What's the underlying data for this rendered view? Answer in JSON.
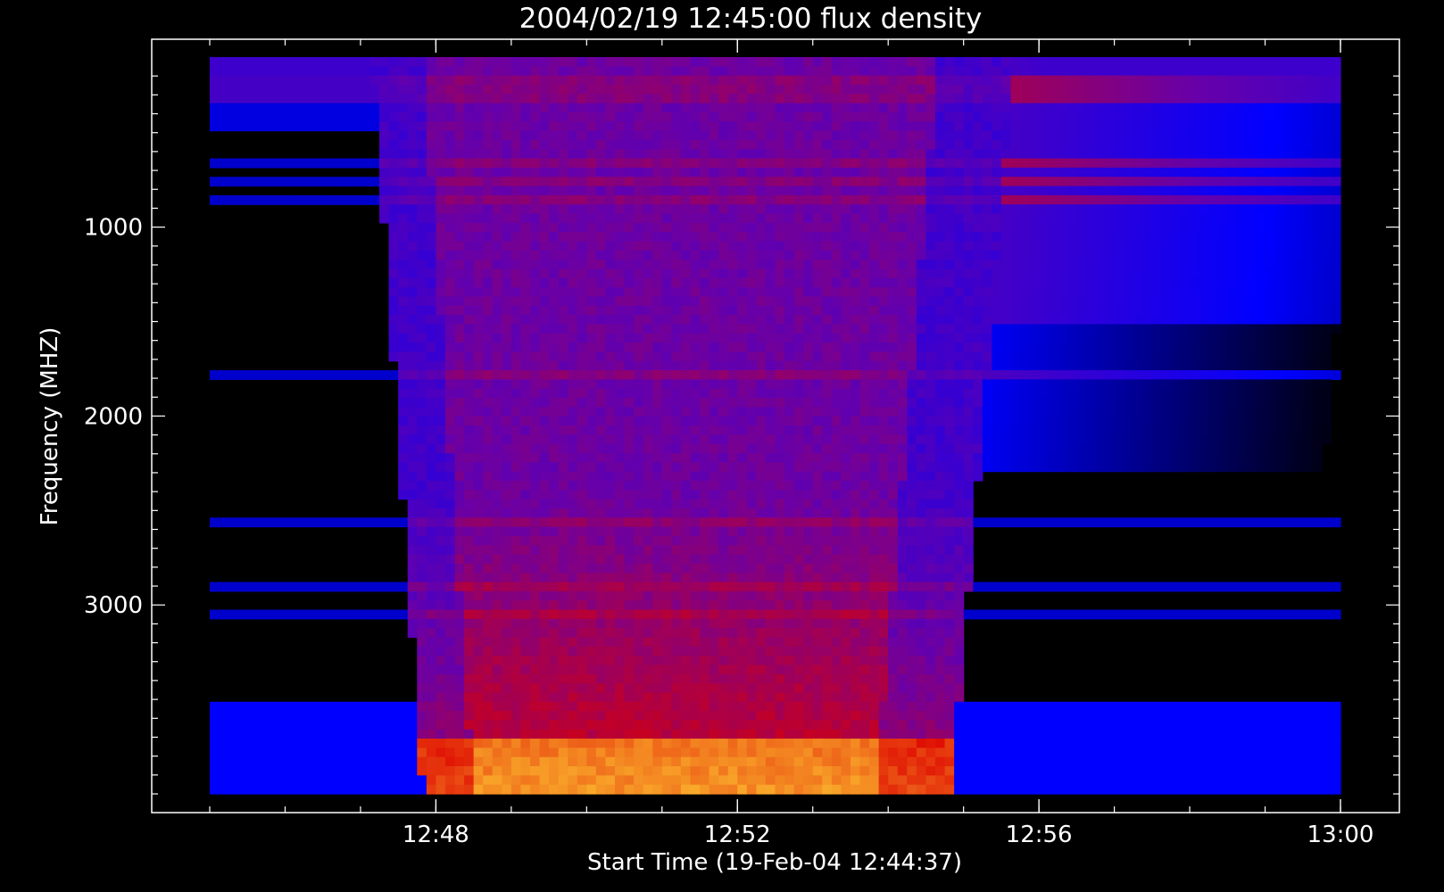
{
  "chart_data": {
    "type": "heatmap",
    "title": "2004/02/19 12:45:00 flux density",
    "xlabel": "Start Time (19-Feb-04 12:44:37)",
    "ylabel": "Frequency (MHZ)",
    "x_tick_labels": [
      "12:48",
      "12:52",
      "12:56",
      "13:00"
    ],
    "y_tick_labels": [
      "1000",
      "2000",
      "3000"
    ],
    "y_ticks": [
      1000,
      2000,
      3000
    ],
    "ylim": [
      4200,
      100
    ],
    "y_axis": "inverted (frequency increases downward)",
    "x_data_start": "12:45:00",
    "x_data_end": "13:00:00",
    "frequency_range_mhz": [
      100,
      4000
    ],
    "colormap": [
      "#000000",
      "#0000ff",
      "#6600aa",
      "#dd0000",
      "#ffcc33"
    ],
    "background_color": "#000000",
    "axis_color": "#ffffff",
    "burst": {
      "onset_top": "12:47:10",
      "onset_bottom": "12:47:50",
      "end_top": "12:55:40",
      "end_bottom": "12:54:50",
      "peak_frequency_band_mhz": [
        3700,
        4000
      ]
    }
  }
}
